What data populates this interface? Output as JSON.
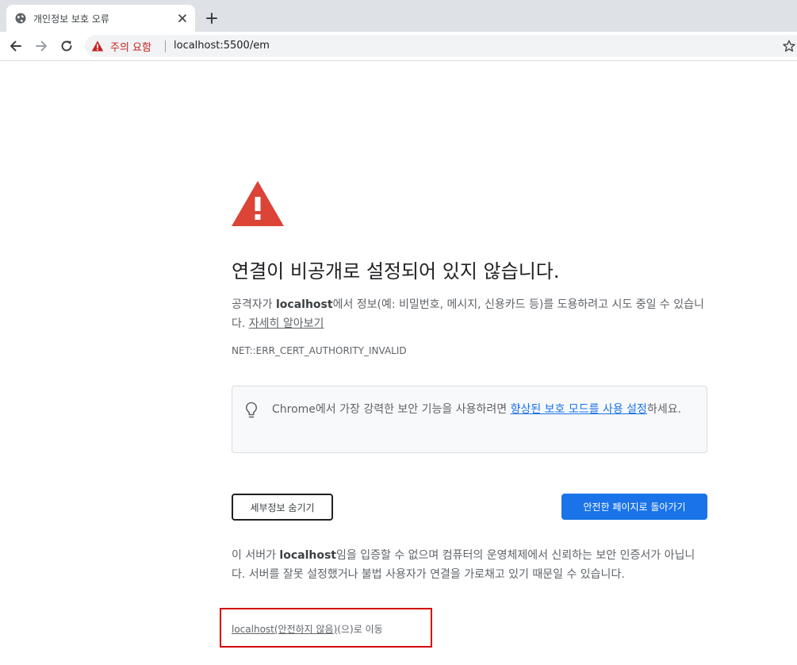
{
  "browser": {
    "tab": {
      "title": "개인정보 보호 오류",
      "favicon": "globe-icon"
    },
    "toolbar": {
      "back_icon": "back-arrow-icon",
      "forward_icon": "forward-arrow-icon",
      "reload_icon": "reload-icon",
      "security_chip_label": "주의 요함",
      "url": "localhost:5500/em",
      "bookmark_icon": "star-icon"
    }
  },
  "interstitial": {
    "heading": "연결이 비공개로 설정되어 있지 않습니다.",
    "explanation": {
      "prefix": "공격자가 ",
      "host": "localhost",
      "suffix": "에서 정보(예: 비밀번호, 메시지, 신용카드 등)를 도용하려고 시도 중일 수 있습니다. ",
      "learn_more": "자세히 알아보기"
    },
    "error_code": "NET::ERR_CERT_AUTHORITY_INVALID",
    "enhanced_protection": {
      "prefix": "Chrome에서 가장 강력한 보안 기능을 사용하려면 ",
      "link": "향상된 보호 모드를 사용 설정",
      "suffix": "하세요."
    },
    "buttons": {
      "details": "세부정보 숨기기",
      "back_to_safety": "안전한 페이지로 돌아가기"
    },
    "details": {
      "prefix": "이 서버가 ",
      "host": "localhost",
      "suffix": "임을 입증할 수 없으며 컴퓨터의 운영체제에서 신뢰하는 보안 인증서가 아닙니다. 서버를 잘못 설정했거나 불법 사용자가 연결을 가로채고 있기 때문일 수 있습니다."
    },
    "proceed": {
      "link": "localhost(안전하지 않음)",
      "suffix": "(으)로 이동"
    }
  },
  "colors": {
    "warning_red": "#db4437",
    "primary_blue": "#1a73e8",
    "annotation_red": "#d40000"
  }
}
